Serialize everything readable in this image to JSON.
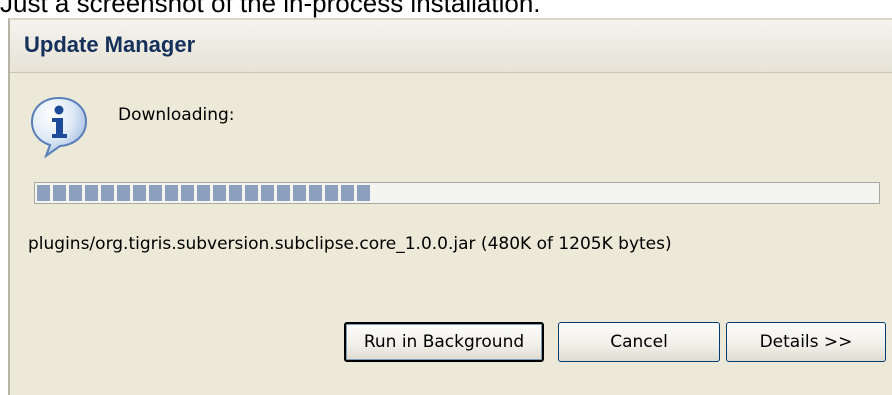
{
  "caption": "Just a screenshot of the in-process installation.",
  "window": {
    "title": "Update Manager"
  },
  "status": {
    "icon": "info-icon",
    "label": "Downloading:"
  },
  "progress": {
    "fraction": 0.4,
    "file_text": "plugins/org.tigris.subversion.subclipse.core_1.0.0.jar (480K of 1205K bytes)"
  },
  "buttons": {
    "run_background": "Run in Background",
    "cancel": "Cancel",
    "details": "Details >>"
  },
  "colors": {
    "title_text": "#15305b",
    "progress_block": "#8d9fbf",
    "dialog_bg": "#ece9d8"
  }
}
